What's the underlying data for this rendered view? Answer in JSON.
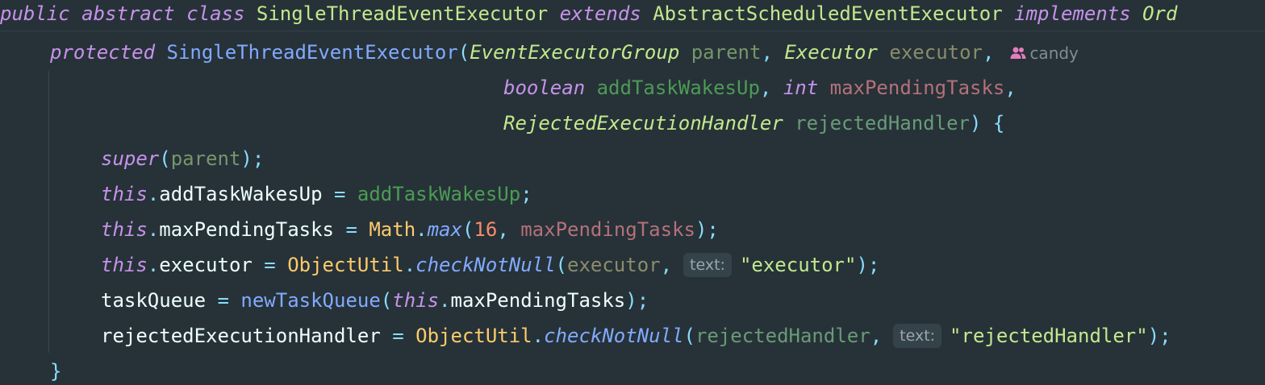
{
  "code": {
    "line1": {
      "kw_public": "public",
      "kw_abstract": "abstract",
      "kw_class": "class",
      "class_name": "SingleThreadEventExecutor",
      "kw_extends": "extends",
      "super_class": "AbstractScheduledEventExecutor",
      "kw_implements": "implements",
      "iface_partial": "Ord"
    },
    "line2": {
      "kw_protected": "protected",
      "ctor_name": "SingleThreadEventExecutor",
      "open_paren": "(",
      "t1": "EventExecutorGroup",
      "p1": "parent",
      "comma1": ",",
      "t2": "Executor",
      "p2": "executor",
      "comma2": ","
    },
    "author": {
      "icon": "users-icon",
      "name": "candy"
    },
    "line3": {
      "t3": "boolean",
      "p3": "addTaskWakesUp",
      "comma3": ",",
      "t4": "int",
      "p4": "maxPendingTasks",
      "comma4": ","
    },
    "line4": {
      "t5": "RejectedExecutionHandler",
      "p5": "rejectedHandler",
      "close": ")",
      "brace": "{"
    },
    "line5": {
      "kw_super": "super",
      "open": "(",
      "arg": "parent",
      "close": ");"
    },
    "line6": {
      "kw_this": "this",
      "dot": ".",
      "field": "addTaskWakesUp",
      "eq": "=",
      "value": "addTaskWakesUp",
      "semi": ";"
    },
    "line7": {
      "kw_this": "this",
      "dot": ".",
      "field": "maxPendingTasks",
      "eq": "=",
      "cls": "Math",
      "dot2": ".",
      "method": "max",
      "open": "(",
      "num": "16",
      "comma": ",",
      "arg": "maxPendingTasks",
      "close": ");"
    },
    "line8": {
      "kw_this": "this",
      "dot": ".",
      "field": "executor",
      "eq": "=",
      "cls": "ObjectUtil",
      "dot2": ".",
      "method": "checkNotNull",
      "open": "(",
      "arg": "executor",
      "comma": ",",
      "hint": "text:",
      "str": "\"executor\"",
      "close": ");"
    },
    "line9": {
      "field": "taskQueue",
      "eq": "=",
      "method": "newTaskQueue",
      "open": "(",
      "kw_this": "this",
      "dot": ".",
      "arg": "maxPendingTasks",
      "close": ");"
    },
    "line10": {
      "field": "rejectedExecutionHandler",
      "eq": "=",
      "cls": "ObjectUtil",
      "dot2": ".",
      "method": "checkNotNull",
      "open": "(",
      "arg": "rejectedHandler",
      "comma": ",",
      "hint": "text:",
      "str": "\"rejectedHandler\"",
      "close": ");"
    },
    "line11": {
      "brace": "}"
    }
  }
}
